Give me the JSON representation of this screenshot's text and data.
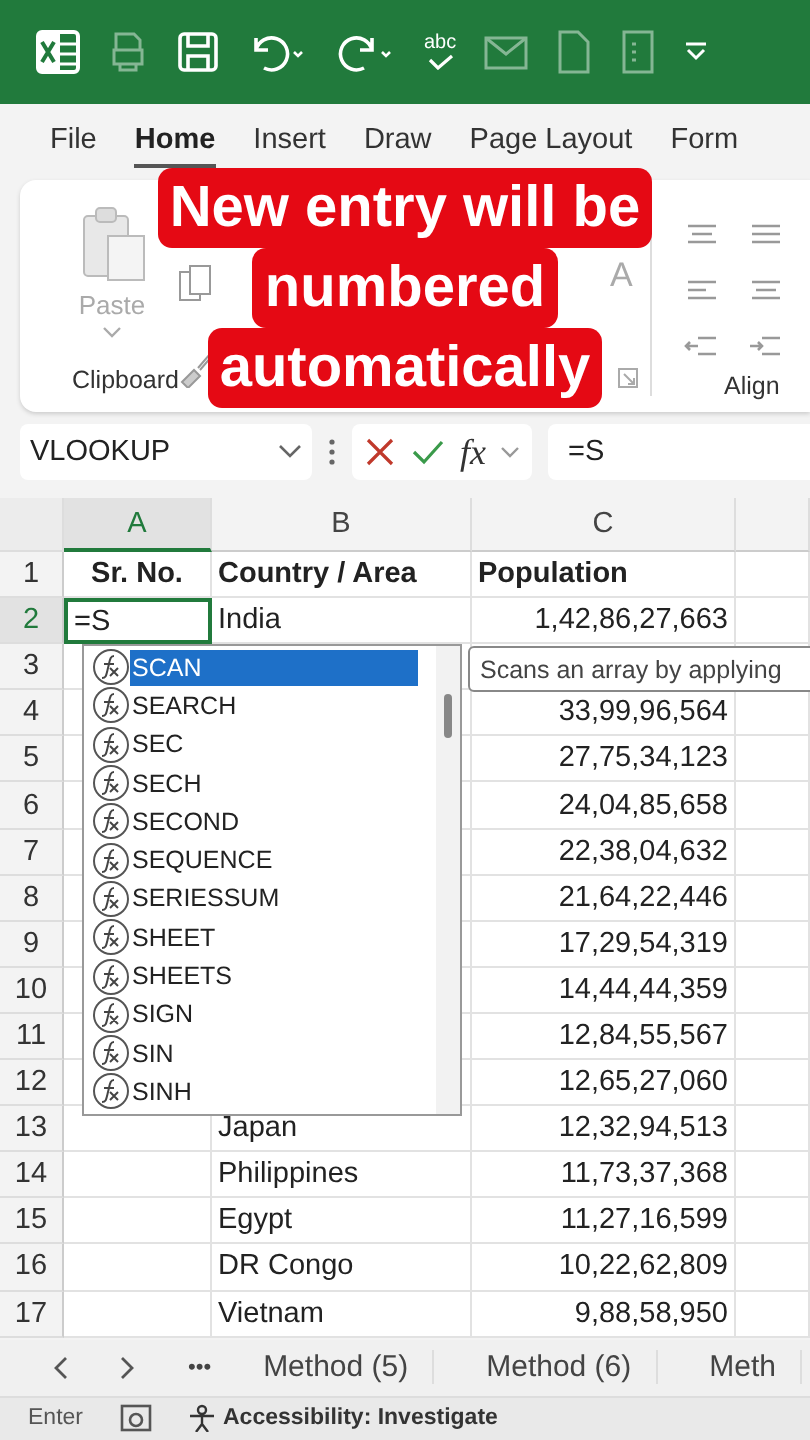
{
  "quick_access": {
    "spelling_label": "abc"
  },
  "menu_tabs": [
    {
      "label": "File",
      "selected": false
    },
    {
      "label": "Home",
      "selected": true
    },
    {
      "label": "Insert",
      "selected": false
    },
    {
      "label": "Draw",
      "selected": false
    },
    {
      "label": "Page Layout",
      "selected": false
    },
    {
      "label": "Form",
      "selected": false
    }
  ],
  "ribbon": {
    "paste_label": "Paste",
    "clipboard_label": "Clipboard",
    "font_label": "A",
    "alignment_label": "Align"
  },
  "caption": [
    "New entry will be",
    "numbered",
    "automatically"
  ],
  "formula_bar": {
    "name_box": "VLOOKUP",
    "fx_label": "fx",
    "formula": "=S"
  },
  "columns": [
    {
      "label": "A",
      "selected": true
    },
    {
      "label": "B",
      "selected": false
    },
    {
      "label": "C",
      "selected": false
    }
  ],
  "rows": [
    {
      "number": "1",
      "kind": "header",
      "selected": false,
      "a": "Sr. No.",
      "b": "Country / Area",
      "c": "Population"
    },
    {
      "number": "2",
      "kind": "data",
      "selected": true,
      "a": "=S",
      "b": "India",
      "c": "1,42,86,27,663"
    },
    {
      "number": "3",
      "kind": "data",
      "selected": false
    },
    {
      "number": "4",
      "kind": "data",
      "selected": false,
      "c": "33,99,96,564"
    },
    {
      "number": "5",
      "kind": "data",
      "selected": false,
      "c": "27,75,34,123"
    },
    {
      "number": "6",
      "kind": "data",
      "selected": false,
      "c": "24,04,85,658"
    },
    {
      "number": "7",
      "kind": "data",
      "selected": false,
      "c": "22,38,04,632"
    },
    {
      "number": "8",
      "kind": "data",
      "selected": false,
      "c": "21,64,22,446"
    },
    {
      "number": "9",
      "kind": "data",
      "selected": false,
      "c": "17,29,54,319"
    },
    {
      "number": "10",
      "kind": "data",
      "selected": false,
      "c": "14,44,44,359"
    },
    {
      "number": "11",
      "kind": "data",
      "selected": false,
      "c": "12,84,55,567"
    },
    {
      "number": "12",
      "kind": "data",
      "selected": false,
      "c": "12,65,27,060"
    },
    {
      "number": "13",
      "kind": "data",
      "selected": false,
      "b": "Japan",
      "c": "12,32,94,513"
    },
    {
      "number": "14",
      "kind": "data",
      "selected": false,
      "b": "Philippines",
      "c": "11,73,37,368"
    },
    {
      "number": "15",
      "kind": "data",
      "selected": false,
      "b": "Egypt",
      "c": "11,27,16,599"
    },
    {
      "number": "16",
      "kind": "data",
      "selected": false,
      "b": "DR Congo",
      "c": "10,22,62,809"
    },
    {
      "number": "17",
      "kind": "data",
      "selected": false,
      "b": "Vietnam",
      "c": "9,88,58,950"
    }
  ],
  "autocomplete": {
    "items": [
      {
        "label": "SCAN",
        "selected": true
      },
      {
        "label": "SEARCH",
        "selected": false
      },
      {
        "label": "SEC",
        "selected": false
      },
      {
        "label": "SECH",
        "selected": false
      },
      {
        "label": "SECOND",
        "selected": false
      },
      {
        "label": "SEQUENCE",
        "selected": false
      },
      {
        "label": "SERIESSUM",
        "selected": false
      },
      {
        "label": "SHEET",
        "selected": false
      },
      {
        "label": "SHEETS",
        "selected": false
      },
      {
        "label": "SIGN",
        "selected": false
      },
      {
        "label": "SIN",
        "selected": false
      },
      {
        "label": "SINH",
        "selected": false
      }
    ]
  },
  "tooltip": "Scans an array by applying",
  "sheet_tabs": {
    "more": "•••",
    "tabs": [
      {
        "label": "Method (5)",
        "selected": false
      },
      {
        "label": "Method (6)",
        "selected": false
      },
      {
        "label": "Meth",
        "selected": false
      }
    ]
  },
  "status_bar": {
    "mode": "Enter",
    "accessibility": "Accessibility: Investigate"
  }
}
